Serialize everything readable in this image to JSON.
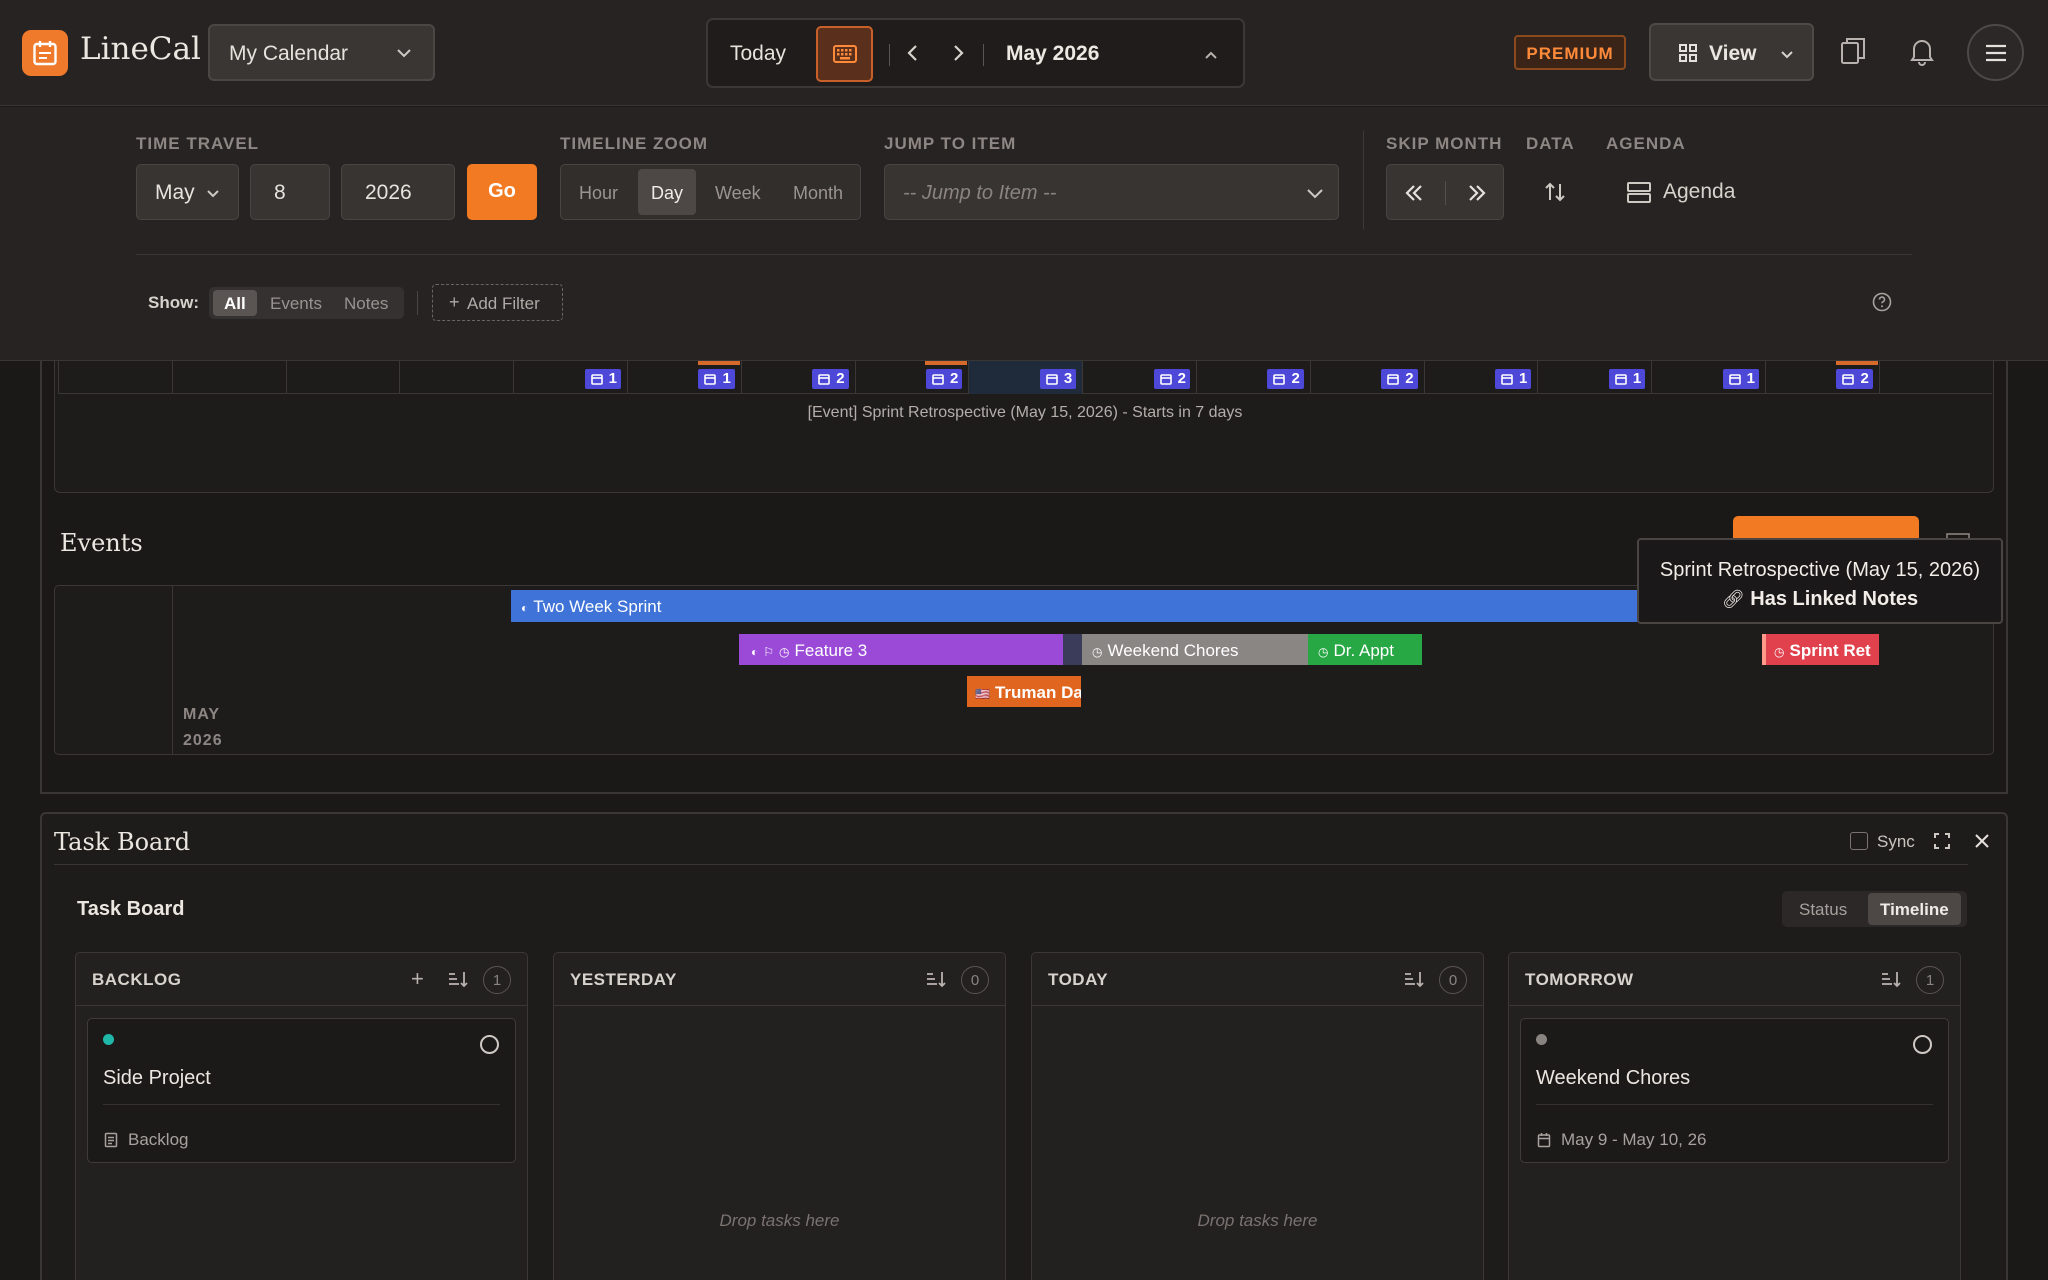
{
  "app": {
    "name": "LineCal",
    "calendar_select": "My Calendar"
  },
  "nav": {
    "today": "Today",
    "month": "May 2026"
  },
  "header": {
    "premium": "PREMIUM",
    "view": "View"
  },
  "toolbar": {
    "time_travel_label": "TIME TRAVEL",
    "month": "May",
    "day": "8",
    "year": "2026",
    "go": "Go",
    "zoom_label": "TIMELINE ZOOM",
    "zoom_options": [
      "Hour",
      "Day",
      "Week",
      "Month"
    ],
    "zoom_selected": "Day",
    "jump_label": "JUMP TO ITEM",
    "jump_placeholder": "-- Jump to Item --",
    "skip_label": "SKIP MONTH",
    "data_label": "DATA",
    "agenda_label": "AGENDA",
    "agenda_button": "Agenda"
  },
  "filter": {
    "show_label": "Show:",
    "options": [
      "All",
      "Events",
      "Notes"
    ],
    "selected": "All",
    "add_filter": "Add Filter"
  },
  "timeline": {
    "day_counts": [
      "1",
      "1",
      "2",
      "2",
      "3",
      "2",
      "2",
      "2",
      "1",
      "1",
      "1",
      "2"
    ],
    "upcoming_text": "[Event] Sprint Retrospective (May 15, 2026) - Starts in 7 days"
  },
  "events": {
    "title": "Events",
    "month_label_1": "MAY",
    "month_label_2": "2026",
    "bars": {
      "two_week_sprint": "Two Week Sprint",
      "feature_3": "Feature 3",
      "weekend_chores": "Weekend Chores",
      "dr_appt": "Dr. Appt",
      "sprint_retro": "Sprint Ret",
      "truman_day": "Truman Da"
    },
    "tooltip_line1": "Sprint Retrospective (May 15, 2026)",
    "tooltip_line2": "Has Linked Notes"
  },
  "task_board": {
    "panel_title": "Task Board",
    "sync_label": "Sync",
    "subtitle": "Task Board",
    "toggle_options": [
      "Status",
      "Timeline"
    ],
    "toggle_selected": "Timeline",
    "columns": [
      {
        "title": "BACKLOG",
        "count": "1",
        "card_title": "Side Project",
        "card_meta": "Backlog",
        "dot_color": "#1fb8a8"
      },
      {
        "title": "YESTERDAY",
        "count": "0",
        "empty_text": "Drop tasks here"
      },
      {
        "title": "TODAY",
        "count": "0",
        "empty_text": "Drop tasks here"
      },
      {
        "title": "TOMORROW",
        "count": "1",
        "card_title": "Weekend Chores",
        "card_meta": "May 9 - May 10, 26",
        "dot_color": "#8a8480"
      }
    ]
  },
  "colors": {
    "accent": "#f27a22",
    "sprint_blue": "#3f73d8",
    "feature_purple": "#9b4ad8",
    "chores_gray": "#8a8684",
    "appt_green": "#28a745",
    "retro_red": "#e0414d",
    "truman_orange": "#e0651e",
    "count_badge": "#4d48d8"
  }
}
